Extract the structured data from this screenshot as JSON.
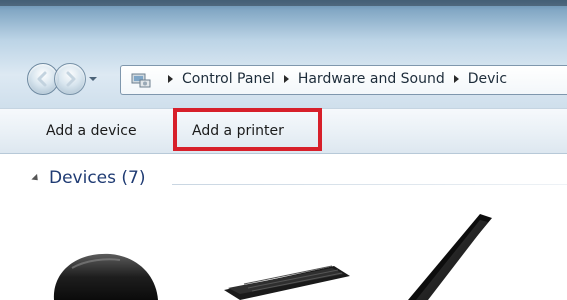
{
  "window": {
    "nav": {
      "back_icon": "back-arrow-icon",
      "forward_icon": "forward-arrow-icon"
    },
    "address_bar": {
      "icon": "control-panel-icon",
      "breadcrumbs": [
        "Control Panel",
        "Hardware and Sound",
        "Devic"
      ]
    },
    "command_bar": {
      "add_device_label": "Add a device",
      "add_printer_label": "Add a printer",
      "highlight_color": "#d71f2a"
    },
    "content": {
      "group_header": "Devices (7)",
      "devices": [
        "mouse-icon",
        "keyboard-icon",
        "monitor-icon"
      ]
    }
  }
}
